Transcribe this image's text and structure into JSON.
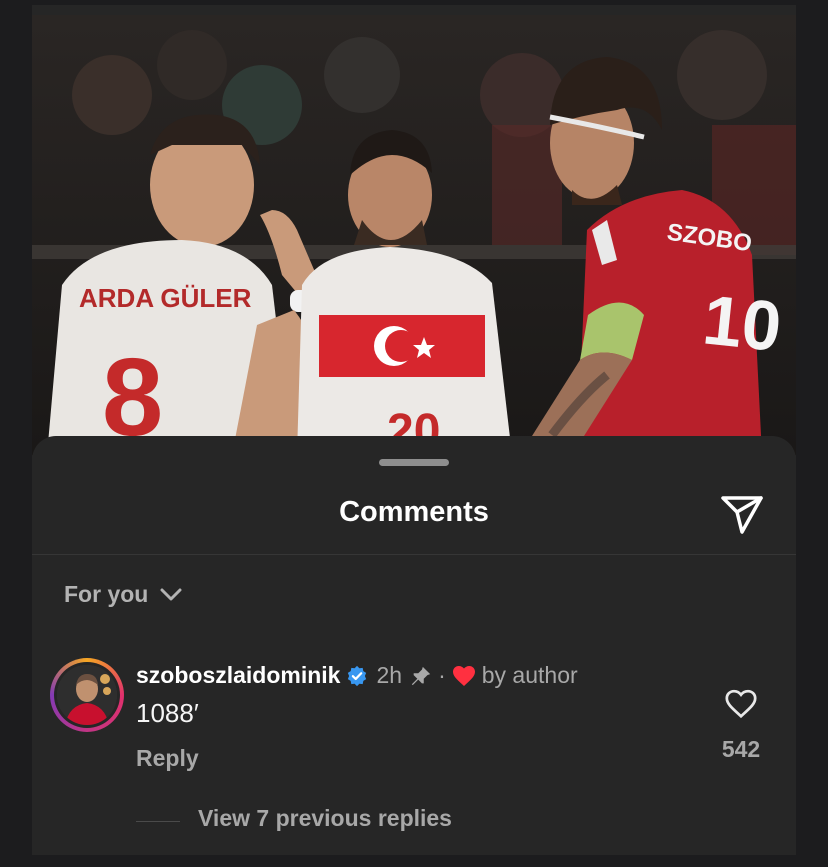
{
  "sheet": {
    "title": "Comments",
    "sort_label": "For you"
  },
  "comment": {
    "username": "szoboszlaidominik",
    "verified": true,
    "time": "2h",
    "pinned": true,
    "liked_by_author_text": "by author",
    "text": "1088′",
    "reply_label": "Reply",
    "like_count": "542",
    "view_replies_label": "View 7 previous replies"
  },
  "photo": {
    "jersey_left_name": "ARDA GÜLER",
    "jersey_left_number": "8",
    "jersey_center_number": "20",
    "jersey_right_name": "SZOBO",
    "jersey_right_number": "10"
  },
  "colors": {
    "background": "#1c1c1e",
    "sheet": "#262626",
    "verified_blue": "#3897f0",
    "heart_red": "#ff3040",
    "turkey_red": "#d7262e",
    "hungary_red": "#b8202b"
  },
  "icons": {
    "share": "paper-plane-icon",
    "sort": "chevron-down-icon",
    "verified": "verified-badge-icon",
    "pin": "pin-icon",
    "author_like": "heart-filled-icon",
    "like": "heart-outline-icon"
  }
}
